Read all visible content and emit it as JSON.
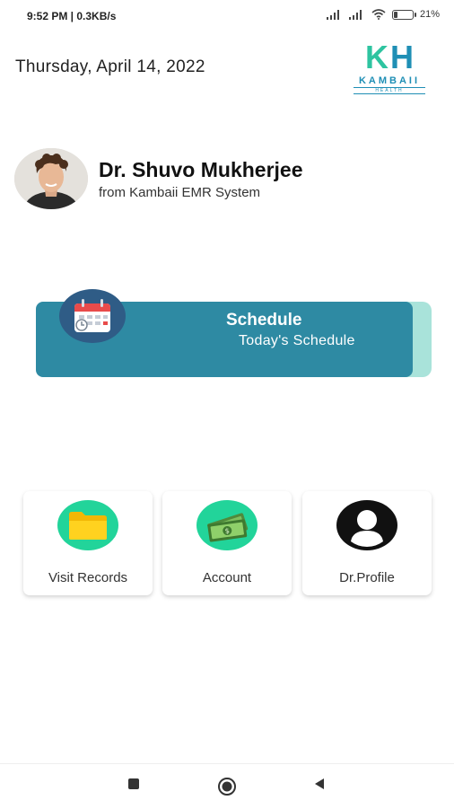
{
  "status": {
    "time": "9:52 PM | 0.3KB/s",
    "battery": "21",
    "battery_level": 0.21,
    "icons": [
      "signal-icon",
      "signal-icon",
      "wifi-icon",
      "battery-icon"
    ]
  },
  "header": {
    "date": "Thursday, April 14, 2022",
    "logo": {
      "k": "K",
      "h": "H",
      "name": "KAMBAII",
      "sub": "HEALTH"
    }
  },
  "profile": {
    "name": "Dr. Shuvo Mukherjee",
    "subtitle": "from Kambaii EMR System"
  },
  "schedule": {
    "title": "Schedule",
    "subtitle": "Today's  Schedule",
    "icon": "calendar-icon"
  },
  "tiles": [
    {
      "label": "Visit Records",
      "icon": "folder-icon",
      "bg": "#22d49a"
    },
    {
      "label": "Account",
      "icon": "money-icon",
      "bg": "#22d49a"
    },
    {
      "label": "Dr.Profile",
      "icon": "user-icon",
      "bg": "#111111"
    }
  ],
  "colors": {
    "accent": "#2e8aa3",
    "accent_light": "#a9e3da",
    "green": "#22d49a",
    "brand_teal": "#2ec4a0",
    "brand_blue": "#1f8fb5"
  },
  "navbar": {
    "icons": [
      "recents-icon",
      "home-icon",
      "back-icon"
    ]
  }
}
